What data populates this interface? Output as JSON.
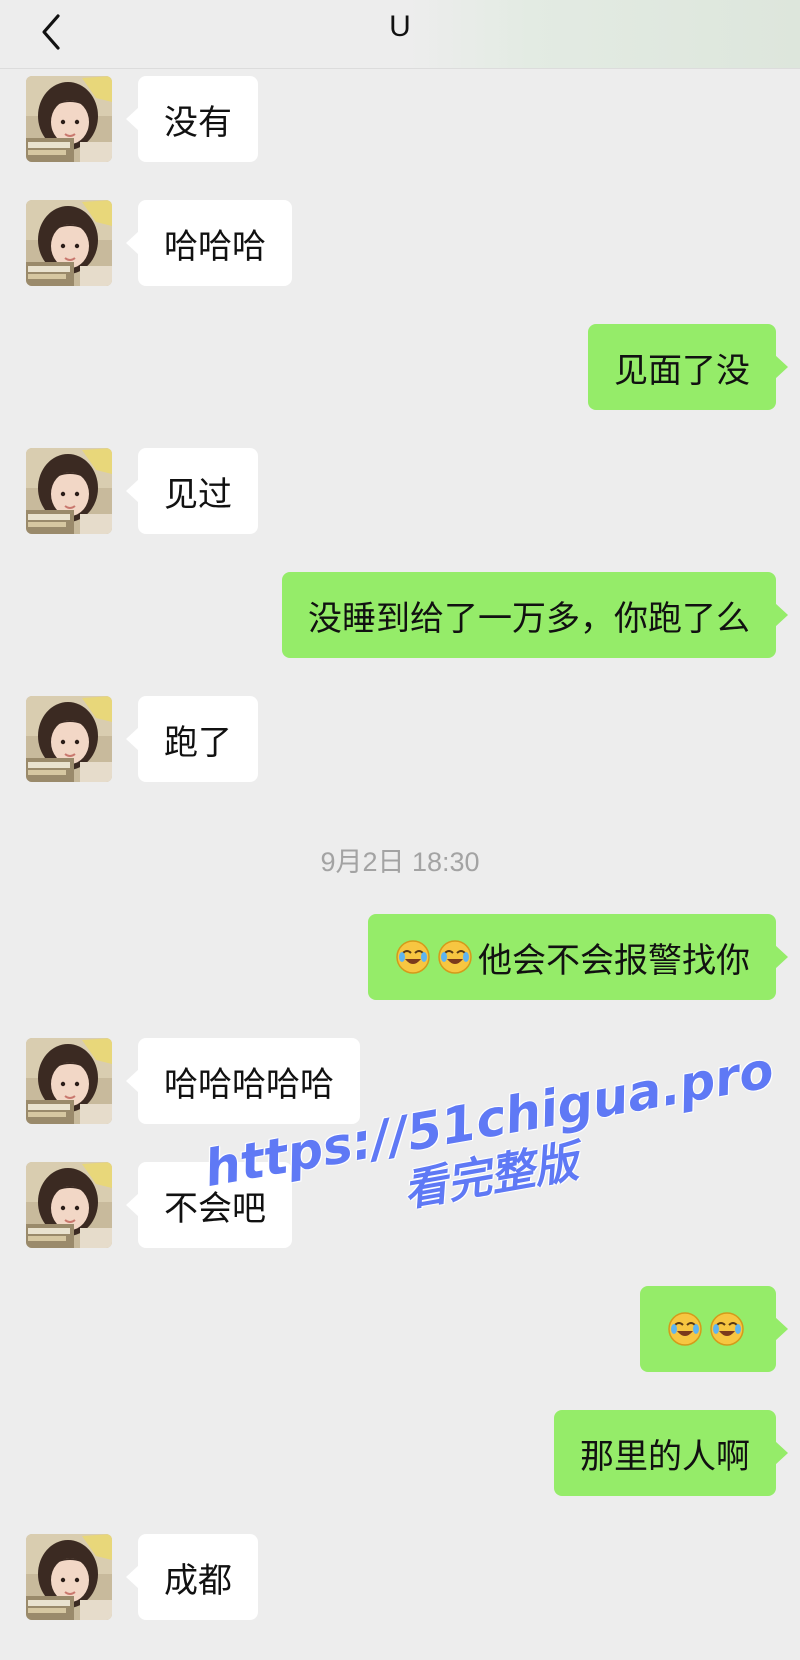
{
  "header": {
    "title": "U"
  },
  "icons": {
    "back": "chevron-left-icon",
    "laugh_cry": "laughing-crying-emoji"
  },
  "colors": {
    "background": "#ededed",
    "incoming_bubble": "#ffffff",
    "outgoing_bubble": "#95ec69",
    "watermark": "#5f79f5"
  },
  "messages": [
    {
      "from": "them",
      "text": "没有"
    },
    {
      "from": "them",
      "text": "哈哈哈"
    },
    {
      "from": "me",
      "text": "见面了没"
    },
    {
      "from": "them",
      "text": "见过"
    },
    {
      "from": "me",
      "text": "没睡到给了一万多，你跑了么"
    },
    {
      "from": "them",
      "text": "跑了"
    },
    {
      "timestamp": "9月2日 18:30"
    },
    {
      "from": "me",
      "emoji_count": 2,
      "text": "他会不会报警找你"
    },
    {
      "from": "them",
      "text": "哈哈哈哈哈"
    },
    {
      "from": "them",
      "text": "不会吧"
    },
    {
      "from": "me",
      "emoji_count": 2,
      "text": ""
    },
    {
      "from": "me",
      "text": "那里的人啊"
    },
    {
      "from": "them",
      "text": "成都"
    }
  ],
  "watermark": {
    "line1": "https://51chigua.pro",
    "line2": "看完整版"
  }
}
